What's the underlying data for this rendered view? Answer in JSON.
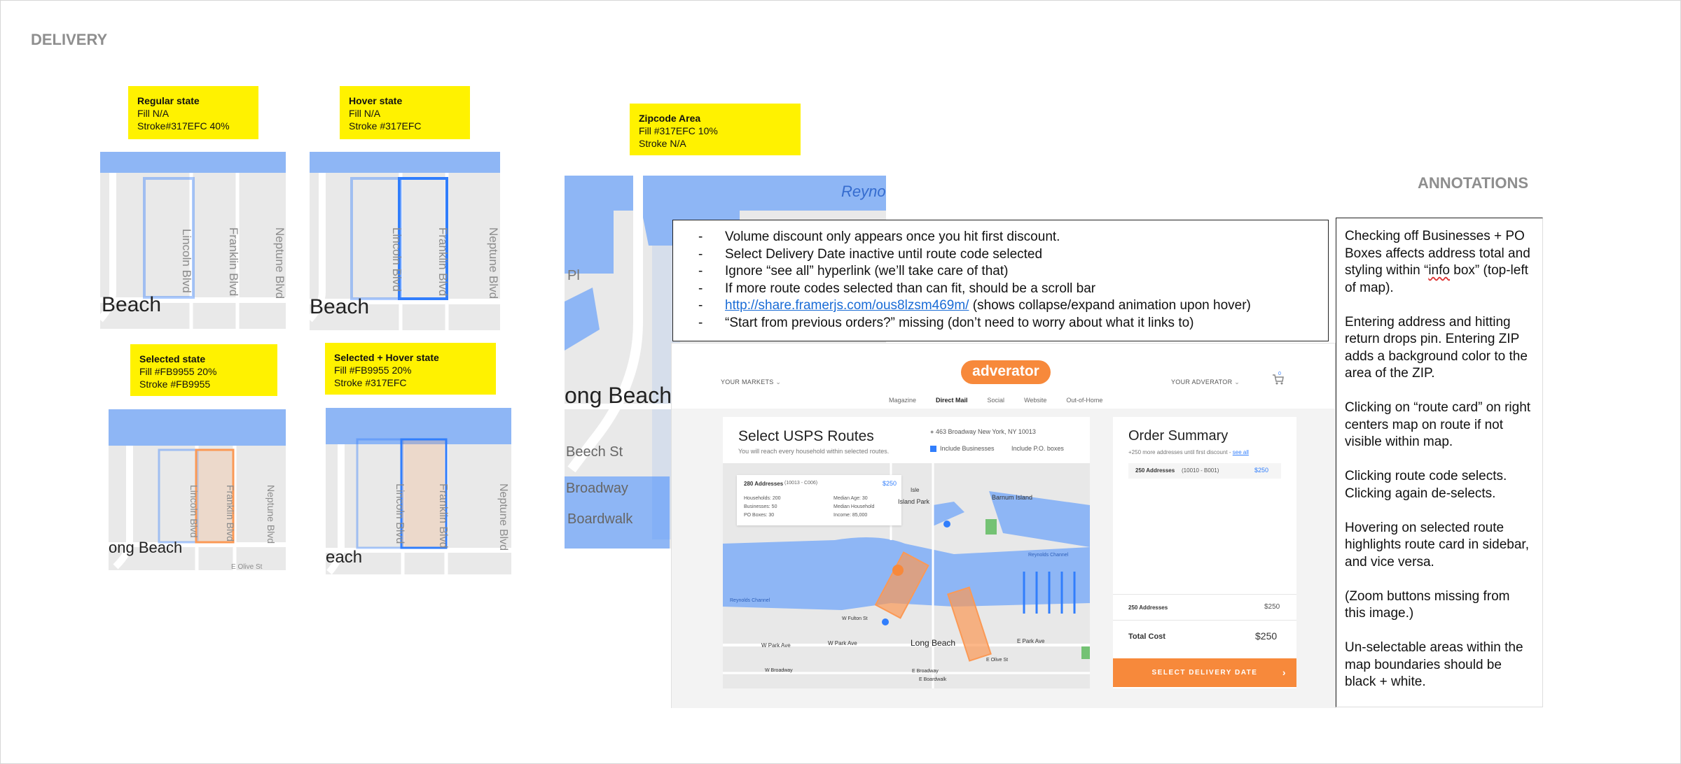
{
  "section": {
    "delivery": "DELIVERY",
    "annotations": "ANNOTATIONS"
  },
  "stickies": {
    "regular": {
      "title": "Regular state",
      "line1": "Fill N/A",
      "line2": "Stroke#317EFC 40%"
    },
    "hover": {
      "title": "Hover state",
      "line1": "Fill N/A",
      "line2": "Stroke #317EFC"
    },
    "zipcode": {
      "title": "Zipcode Area",
      "line1": "Fill #317EFC 10%",
      "line2": "Stroke N/A"
    },
    "selected": {
      "title": "Selected state",
      "line1": "Fill #FB9955 20%",
      "line2": "Stroke #FB9955"
    },
    "selected_hover": {
      "title": "Selected + Hover state",
      "line1": "Fill #FB9955 20%",
      "line2": "Stroke #317EFC"
    }
  },
  "map_labels": {
    "lincoln": "Lincoln Blvd",
    "franklin": "Franklin Blvd",
    "neptune": "Neptune Blvd",
    "beach": "Beach",
    "ong_beach": "ong Beach",
    "each": "each",
    "olive": "E Olive St",
    "reyno": "Reyno",
    "pl": "Pl",
    "long_beach": "ong Beach",
    "beech": "Beech St",
    "broadway": "Broadway",
    "boardwalk": "Boardwalk"
  },
  "notes": [
    {
      "text": "Volume discount only appears once you hit first discount."
    },
    {
      "text": "Select Delivery Date inactive until route code selected"
    },
    {
      "text": "Ignore “see all” hyperlink (we’ll take care of that)"
    },
    {
      "text": "If more route codes selected than can fit, should be a scroll bar"
    },
    {
      "link": "http://share.framerjs.com/ous8lzsm469m/",
      "text": " (shows collapse/expand animation upon hover)"
    },
    {
      "text": "“Start from previous orders?” missing (don’t need to worry about what it links to)"
    }
  ],
  "annotations": [
    {
      "pre": "Checking off Businesses + PO Boxes affects address total and styling within “",
      "mark": "info",
      "post": " box” (top-left of map)."
    },
    {
      "pre": "Entering address and hitting return drops pin. Entering ZIP adds a background color to the area of the ZIP.",
      "mark": "",
      "post": ""
    },
    {
      "pre": "Clicking on “route card” on right centers map on route if not visible within map.",
      "mark": "",
      "post": ""
    },
    {
      "pre": "Clicking route code selects. Clicking again de-selects.",
      "mark": "",
      "post": ""
    },
    {
      "pre": "Hovering on selected route highlights route card in sidebar, and vice versa.",
      "mark": "",
      "post": ""
    },
    {
      "pre": "(Zoom buttons missing from this image.)",
      "mark": "",
      "post": ""
    },
    {
      "pre": "Un-selectable areas within the map boundaries should be black + white.",
      "mark": "",
      "post": ""
    }
  ],
  "mock": {
    "logo": "adverator",
    "your_markets": "YOUR MARKETS",
    "your_adverator": "YOUR ADVERATOR",
    "cart_count": "0",
    "nav": [
      "Magazine",
      "Direct Mail",
      "Social",
      "Website",
      "Out-of-Home"
    ],
    "routes_title": "Select USPS Routes",
    "routes_sub": "You will reach every household within selected routes.",
    "address": "463 Broadway New York, NY 10013",
    "include_businesses": "Include Businesses",
    "include_po": "Include P.O. boxes",
    "info_addresses": "280 Addresses",
    "info_range": "(10013 - C006)",
    "info_price": "$250",
    "info_left": [
      "Households: 200",
      "Businesses: 50",
      "PO Boxes: 30"
    ],
    "info_right": [
      "Median Age: 30",
      "Median Household",
      "Income: 85,000"
    ],
    "map_places": {
      "island_park": "Island Park",
      "barnum": "Barnum Island",
      "reynolds": "Reynolds Channel",
      "reynolds2": "Reynolds Channel",
      "long_beach": "Long Beach",
      "w_park": "W Park Ave",
      "e_park": "E Park Ave",
      "w_fulton": "W Fulton St",
      "e_olive": "E Olive St",
      "isle": "Isle",
      "w_broadway": "W Broadway",
      "broadway": "E Broadway",
      "boardwalk": "E Boardwalk"
    },
    "order_title": "Order Summary",
    "order_sub": "+250 more addresses until first discount -",
    "see_all": "see all",
    "order_item": "250 Addresses",
    "order_item_range": "(10010 - B001)",
    "order_item_price": "$250",
    "subtotal_label": "250 Addresses",
    "subtotal_value": "$250",
    "total_label": "Total Cost",
    "total_value": "$250",
    "cta": "SELECT DELIVERY DATE",
    "cta_arrow": "›"
  },
  "colors": {
    "blue": "#317EFC",
    "orange": "#FB9955",
    "sticky": "#FFF200",
    "water": "#8EB6F5"
  }
}
